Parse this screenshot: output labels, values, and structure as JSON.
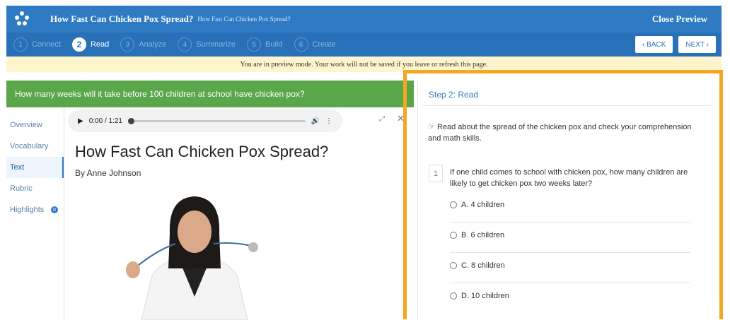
{
  "header": {
    "title": "How Fast Can Chicken Pox Spread?",
    "subtitle": "How Fast Can Chicken Pox Spread?",
    "close_label": "Close Preview"
  },
  "steps": [
    {
      "num": "1",
      "label": "Connect"
    },
    {
      "num": "2",
      "label": "Read"
    },
    {
      "num": "3",
      "label": "Analyze"
    },
    {
      "num": "4",
      "label": "Summarize"
    },
    {
      "num": "5",
      "label": "Build"
    },
    {
      "num": "6",
      "label": "Create"
    }
  ],
  "nav_buttons": {
    "back": "‹ BACK",
    "next": "NEXT ›"
  },
  "notice": "You are in preview mode. Your work will not be saved if you leave or refresh this page.",
  "question_banner": "How many weeks will it take before 100 children at school have chicken pox?",
  "sidenav": {
    "items": [
      "Overview",
      "Vocabulary",
      "Text",
      "Rubric",
      "Highlights"
    ],
    "highlights_count": "0"
  },
  "audio": {
    "time": "0:00 / 1:21"
  },
  "reading": {
    "title": "How Fast Can Chicken Pox Spread?",
    "byline": "By Anne Johnson"
  },
  "panel": {
    "step_title": "Step 2: Read",
    "instruction": "Read about the spread of the chicken pox and check your comprehension and math skills.",
    "question_num": "1",
    "question": "If one child comes to school with chicken pox, how many children are likely to get chicken pox two weeks later?",
    "options": [
      "A. 4 children",
      "B. 6 children",
      "C. 8 children",
      "D. 10 children"
    ]
  },
  "colors": {
    "primary": "#2e7bc4",
    "banner_green": "#5aa64a",
    "highlight_orange": "#f5a623"
  }
}
